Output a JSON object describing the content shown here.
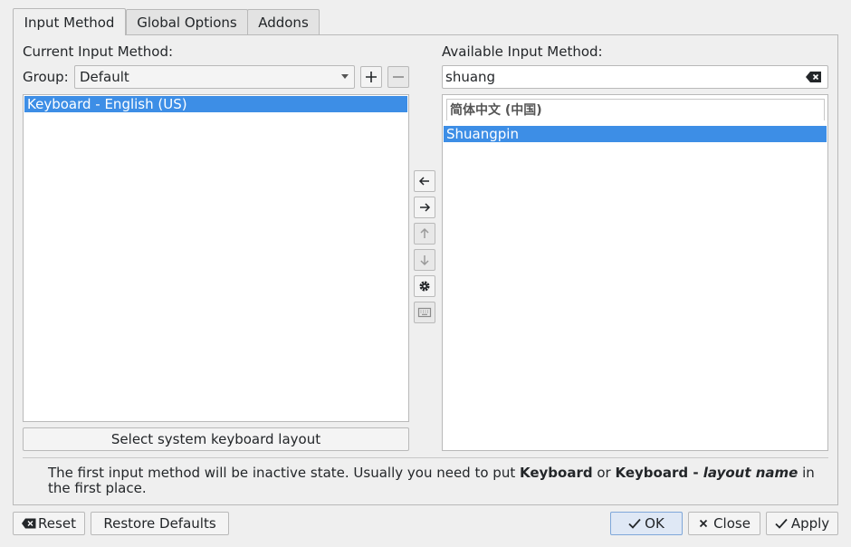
{
  "tabs": [
    "Input Method",
    "Global Options",
    "Addons"
  ],
  "left": {
    "heading": "Current Input Method:",
    "group_label": "Group:",
    "group_value": "Default",
    "items": [
      "Keyboard - English (US)"
    ],
    "select_layout_button": "Select system keyboard layout"
  },
  "right": {
    "heading": "Available Input Method:",
    "search_value": "shuang",
    "category": "简体中文 (中国)",
    "items": [
      "Shuangpin"
    ]
  },
  "info": {
    "text_prefix": "The first input method will be inactive state. Usually you need to put ",
    "bold1": "Keyboard",
    "mid": " or ",
    "bold2": "Keyboard - ",
    "italic": "layout name",
    "suffix_line1": " in",
    "line2": "the first place."
  },
  "footer": {
    "reset_label": "Reset",
    "restore_defaults_label": "Restore Defaults",
    "ok_label": "OK",
    "close_label": "Close",
    "apply_label": "Apply"
  },
  "colors": {
    "selection": "#3d8ee6",
    "window_bg": "#efefef"
  }
}
